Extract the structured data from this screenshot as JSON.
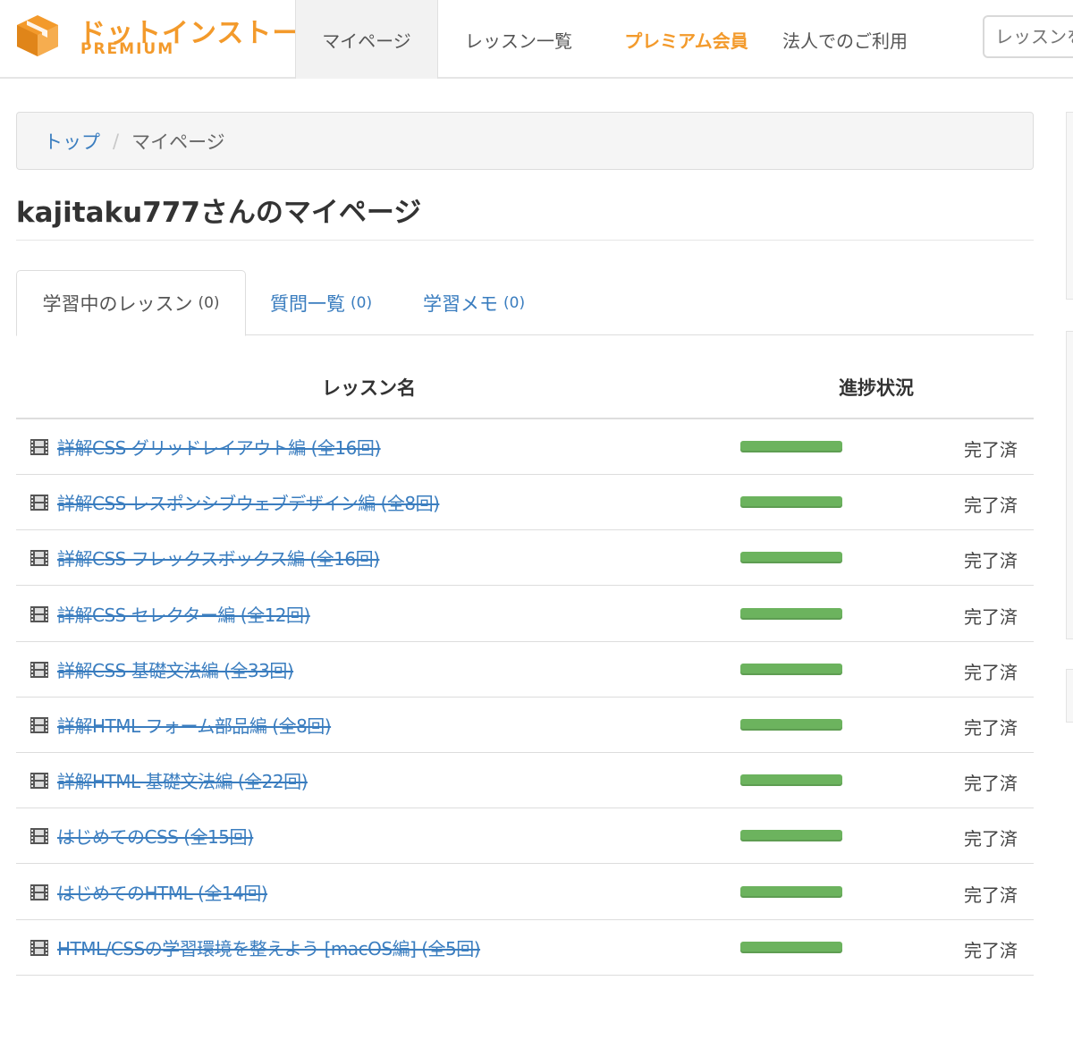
{
  "header": {
    "logo_title": "ドットインストール",
    "logo_sub": "PREMIUM",
    "nav": [
      {
        "label": "マイページ"
      },
      {
        "label": "レッスン一覧"
      },
      {
        "label": "プレミアム会員"
      },
      {
        "label": "法人でのご利用"
      }
    ],
    "search_placeholder": "レッスンを検索",
    "accent_color": "#f39a2b"
  },
  "breadcrumb": {
    "home": "トップ",
    "separator": "/",
    "current": "マイページ"
  },
  "page_title": "kajitaku777さんのマイページ",
  "tabs": [
    {
      "label": "学習中のレッスン",
      "count": "(0)"
    },
    {
      "label": "質問一覧",
      "count": "(0)"
    },
    {
      "label": "学習メモ",
      "count": "(0)"
    }
  ],
  "table": {
    "col_name": "レッスン名",
    "col_progress": "進捗状況",
    "rows": [
      {
        "title": "詳解CSS グリッドレイアウト編 (全16回)",
        "progress": 1.0,
        "status": "完了済"
      },
      {
        "title": "詳解CSS レスポンシブウェブデザイン編 (全8回)",
        "progress": 1.0,
        "status": "完了済"
      },
      {
        "title": "詳解CSS フレックスボックス編 (全16回)",
        "progress": 1.0,
        "status": "完了済"
      },
      {
        "title": "詳解CSS セレクター編 (全12回)",
        "progress": 1.0,
        "status": "完了済"
      },
      {
        "title": "詳解CSS 基礎文法編 (全33回)",
        "progress": 1.0,
        "status": "完了済"
      },
      {
        "title": "詳解HTML フォーム部品編 (全8回)",
        "progress": 1.0,
        "status": "完了済"
      },
      {
        "title": "詳解HTML 基礎文法編 (全22回)",
        "progress": 1.0,
        "status": "完了済"
      },
      {
        "title": "はじめてのCSS (全15回)",
        "progress": 1.0,
        "status": "完了済"
      },
      {
        "title": "はじめてのHTML (全14回)",
        "progress": 1.0,
        "status": "完了済"
      },
      {
        "title": "HTML/CSSの学習環境を整えよう [macOS編] (全5回)",
        "progress": 1.0,
        "status": "完了済"
      }
    ],
    "progress_color": "#6cb35e"
  },
  "icons": {
    "lesson_icon": "film-icon",
    "logo_icon": "box-icon"
  }
}
